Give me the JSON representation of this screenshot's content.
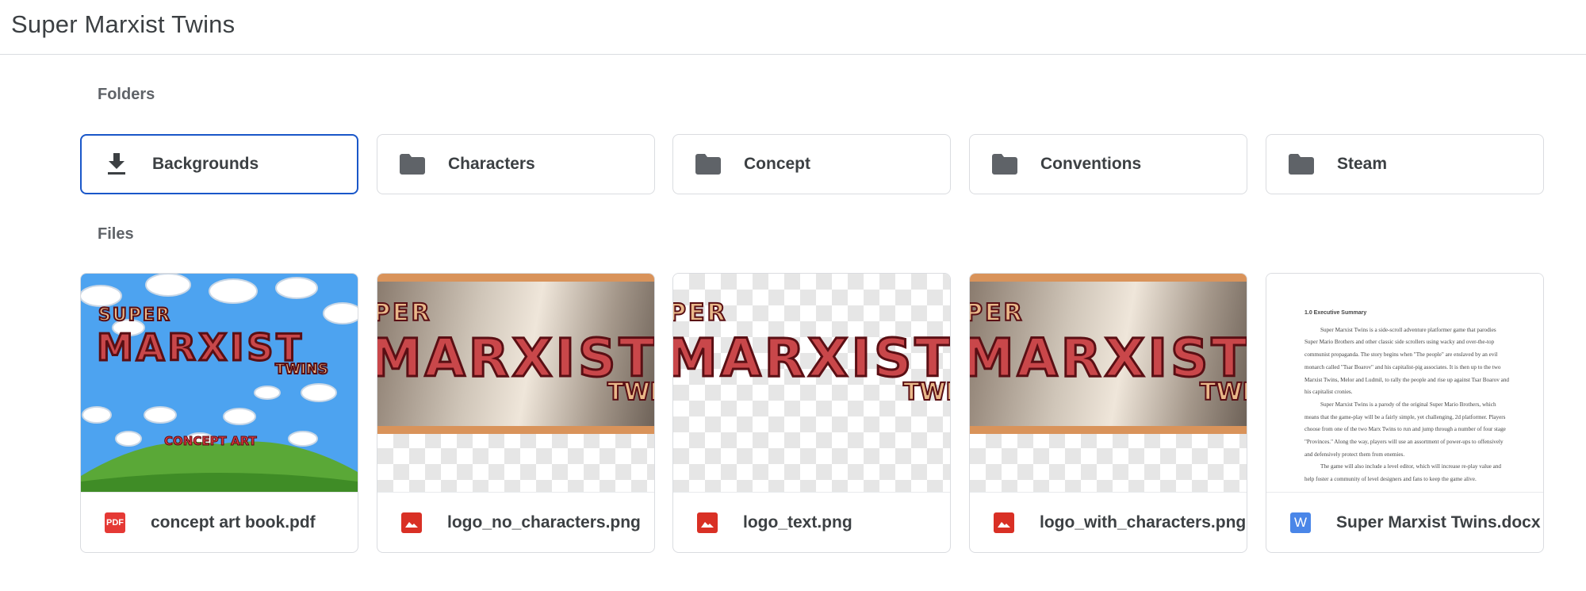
{
  "header": {
    "title": "Super Marxist Twins"
  },
  "sections": {
    "folders_label": "Folders",
    "files_label": "Files"
  },
  "folders": [
    {
      "name": "Backgrounds",
      "icon": "download-icon",
      "selected": true
    },
    {
      "name": "Characters",
      "icon": "folder-icon"
    },
    {
      "name": "Concept",
      "icon": "folder-icon"
    },
    {
      "name": "Conventions",
      "icon": "folder-icon"
    },
    {
      "name": "Steam",
      "icon": "folder-icon"
    }
  ],
  "files": [
    {
      "name": "concept art book.pdf",
      "type_icon": "pdf-icon",
      "type_label": "PDF",
      "thumb": {
        "line1": "SUPER",
        "line2": "MARXIST",
        "line3": "TWINS",
        "line4": "CONCEPT ART"
      }
    },
    {
      "name": "logo_no_characters.png",
      "type_icon": "image-icon",
      "thumb": {
        "line1": "PER",
        "line2": "MARXIST",
        "line3": "TWI"
      }
    },
    {
      "name": "logo_text.png",
      "type_icon": "image-icon",
      "thumb": {
        "line1": "PER",
        "line2": "MARXIST",
        "line3": "TWI"
      }
    },
    {
      "name": "logo_with_characters.png",
      "type_icon": "image-icon",
      "thumb": {
        "line1": "PER",
        "line2": "MARXIST",
        "line3": "TWI"
      }
    },
    {
      "name": "Super Marxist Twins.docx",
      "type_icon": "word-doc-icon",
      "type_label": "W",
      "thumb": {
        "heading": "1.0 Executive Summary",
        "p1": "Super Marxist Twins is a side-scroll adventure platformer game that parodies Super Mario Brothers and other classic side scrollers using wacky and over-the-top communist propaganda. The story begins when \"The people\" are enslaved by an evil monarch called \"Tsar Boarov\" and his capitalist-pig associates. It is then up to the two Marxist Twins, Melor and Ludmil, to rally the people and rise up against Tsar Boarov and his capitalist cronies.",
        "p2": "Super Marxist Twins is a parody of the original Super Mario Brothers, which means that the game-play will be a fairly simple, yet challenging, 2d platformer. Players choose from one of the two Marx Twins to run and jump through a number of four stage \"Provinces.\" Along the way, players will use an assortment of power-ups to offensively and defensively protect them from enemies.",
        "p3": "The game will also include a level editor, which will increase re-play value and help foster a community of level designers and fans to keep the game alive."
      }
    }
  ],
  "colors": {
    "accent": "#1a57c9",
    "pdf": "#e53935",
    "image": "#d93025",
    "word": "#4a86e8",
    "folder": "#5f6368"
  }
}
